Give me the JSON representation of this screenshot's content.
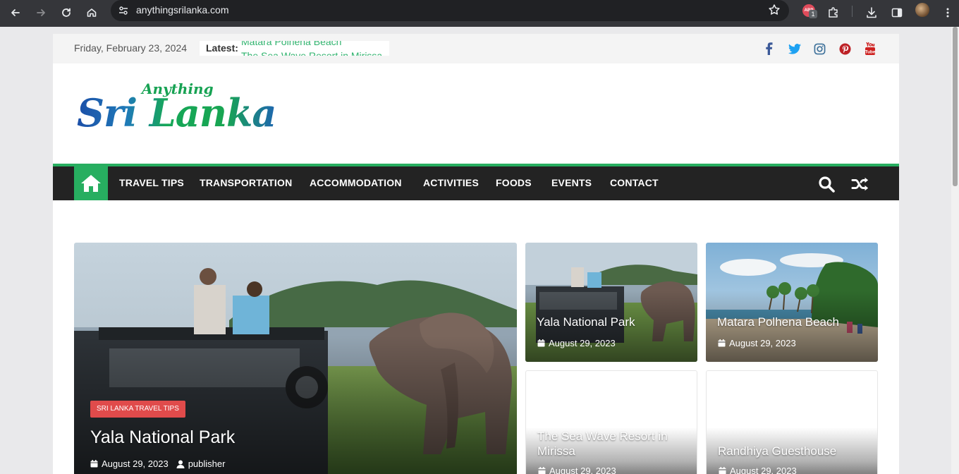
{
  "browser": {
    "url": "anythingsrilanka.com",
    "extension_badge_text": "ABP",
    "extension_count": "1"
  },
  "topbar": {
    "date": "Friday, February 23, 2024",
    "latest_label": "Latest:",
    "ticker": [
      "Matara Polhena Beach",
      "The Sea Wave Resort in Mirissa"
    ],
    "social_icons": [
      "facebook-icon",
      "twitter-icon",
      "instagram-icon",
      "pinterest-icon",
      "youtube-icon"
    ],
    "social_colors": {
      "facebook": "#3b5998",
      "twitter": "#1da1f2",
      "instagram": "#3f729b",
      "pinterest": "#bd2126",
      "youtube": "#cd201f"
    }
  },
  "logo": {
    "small": "Anything",
    "big": "Sri Lanka"
  },
  "nav": {
    "items": [
      "TRAVEL TIPS",
      "TRANSPORTATION",
      "ACCOMMODATION",
      "ACTIVITIES",
      "FOODS",
      "EVENTS",
      "CONTACT"
    ],
    "accent": "#27ae60",
    "background": "#232323"
  },
  "featured": {
    "category": "SRI LANKA TRAVEL TIPS",
    "title": "Yala National Park",
    "date": "August 29, 2023",
    "author": "publisher"
  },
  "grid": [
    {
      "title": "Yala National Park",
      "date": "August 29, 2023"
    },
    {
      "title": "Matara Polhena Beach",
      "date": "August 29, 2023"
    },
    {
      "title": "The Sea Wave Resort in Mirissa",
      "date": "August 29, 2023"
    },
    {
      "title": "Randhiya Guesthouse",
      "date": "August 29, 2023"
    }
  ]
}
